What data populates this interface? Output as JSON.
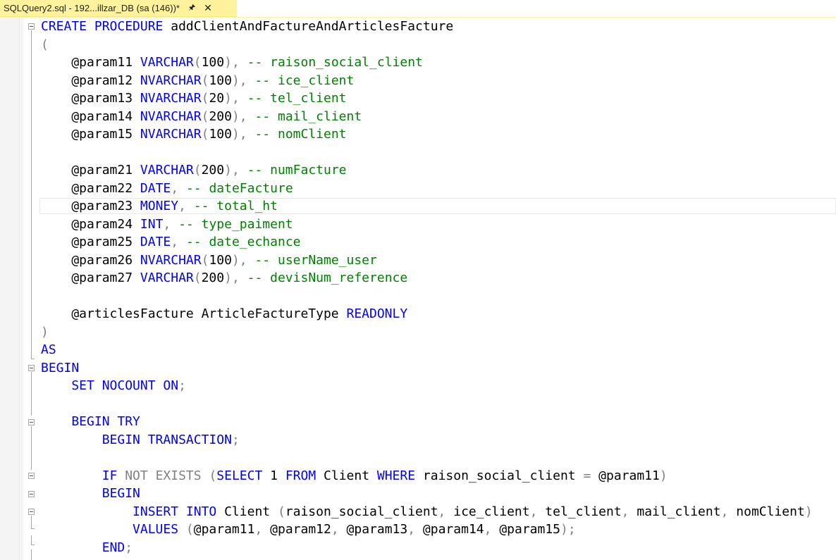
{
  "tab": {
    "title": "SQLQuery2.sql - 192...illzar_DB (sa (146))*",
    "pin_icon": "pin-icon",
    "close_icon": "close-icon"
  },
  "code_lines": [
    [
      {
        "t": "CREATE PROCEDURE ",
        "c": "kw"
      },
      {
        "t": "addClientAndFactureAndArticlesFacture",
        "c": "id"
      }
    ],
    [
      {
        "t": "(",
        "c": "op"
      }
    ],
    [
      {
        "t": "    @param11 ",
        "c": "id"
      },
      {
        "t": "VARCHAR",
        "c": "kw"
      },
      {
        "t": "(",
        "c": "op"
      },
      {
        "t": "100",
        "c": "id"
      },
      {
        "t": "), ",
        "c": "op"
      },
      {
        "t": "-- raison_social_client",
        "c": "cm"
      }
    ],
    [
      {
        "t": "    @param12 ",
        "c": "id"
      },
      {
        "t": "NVARCHAR",
        "c": "kw"
      },
      {
        "t": "(",
        "c": "op"
      },
      {
        "t": "100",
        "c": "id"
      },
      {
        "t": "), ",
        "c": "op"
      },
      {
        "t": "-- ice_client",
        "c": "cm"
      }
    ],
    [
      {
        "t": "    @param13 ",
        "c": "id"
      },
      {
        "t": "NVARCHAR",
        "c": "kw"
      },
      {
        "t": "(",
        "c": "op"
      },
      {
        "t": "20",
        "c": "id"
      },
      {
        "t": "), ",
        "c": "op"
      },
      {
        "t": "-- tel_client",
        "c": "cm"
      }
    ],
    [
      {
        "t": "    @param14 ",
        "c": "id"
      },
      {
        "t": "NVARCHAR",
        "c": "kw"
      },
      {
        "t": "(",
        "c": "op"
      },
      {
        "t": "200",
        "c": "id"
      },
      {
        "t": "), ",
        "c": "op"
      },
      {
        "t": "-- mail_client",
        "c": "cm"
      }
    ],
    [
      {
        "t": "    @param15 ",
        "c": "id"
      },
      {
        "t": "NVARCHAR",
        "c": "kw"
      },
      {
        "t": "(",
        "c": "op"
      },
      {
        "t": "100",
        "c": "id"
      },
      {
        "t": "), ",
        "c": "op"
      },
      {
        "t": "-- nomClient",
        "c": "cm"
      }
    ],
    [],
    [
      {
        "t": "    @param21 ",
        "c": "id"
      },
      {
        "t": "VARCHAR",
        "c": "kw"
      },
      {
        "t": "(",
        "c": "op"
      },
      {
        "t": "200",
        "c": "id"
      },
      {
        "t": "), ",
        "c": "op"
      },
      {
        "t": "-- numFacture",
        "c": "cm"
      }
    ],
    [
      {
        "t": "    @param22 ",
        "c": "id"
      },
      {
        "t": "DATE",
        "c": "kw"
      },
      {
        "t": ", ",
        "c": "op"
      },
      {
        "t": "-- dateFacture",
        "c": "cm"
      }
    ],
    [
      {
        "t": "    @param23 ",
        "c": "id"
      },
      {
        "t": "MONEY",
        "c": "kw"
      },
      {
        "t": ", ",
        "c": "op"
      },
      {
        "t": "-- total_ht",
        "c": "cm"
      }
    ],
    [
      {
        "t": "    @param24 ",
        "c": "id"
      },
      {
        "t": "INT",
        "c": "kw"
      },
      {
        "t": ", ",
        "c": "op"
      },
      {
        "t": "-- type_paiment",
        "c": "cm"
      }
    ],
    [
      {
        "t": "    @param25 ",
        "c": "id"
      },
      {
        "t": "DATE",
        "c": "kw"
      },
      {
        "t": ", ",
        "c": "op"
      },
      {
        "t": "-- date_echance",
        "c": "cm"
      }
    ],
    [
      {
        "t": "    @param26 ",
        "c": "id"
      },
      {
        "t": "NVARCHAR",
        "c": "kw"
      },
      {
        "t": "(",
        "c": "op"
      },
      {
        "t": "100",
        "c": "id"
      },
      {
        "t": "), ",
        "c": "op"
      },
      {
        "t": "-- userName_user",
        "c": "cm"
      }
    ],
    [
      {
        "t": "    @param27 ",
        "c": "id"
      },
      {
        "t": "VARCHAR",
        "c": "kw"
      },
      {
        "t": "(",
        "c": "op"
      },
      {
        "t": "200",
        "c": "id"
      },
      {
        "t": "), ",
        "c": "op"
      },
      {
        "t": "-- devisNum_reference",
        "c": "cm"
      }
    ],
    [],
    [
      {
        "t": "    @articlesFacture ArticleFactureType ",
        "c": "id"
      },
      {
        "t": "READONLY",
        "c": "kw"
      }
    ],
    [
      {
        "t": ")",
        "c": "op"
      }
    ],
    [
      {
        "t": "AS",
        "c": "kw"
      }
    ],
    [
      {
        "t": "BEGIN",
        "c": "kw"
      }
    ],
    [
      {
        "t": "    SET NOCOUNT ON",
        "c": "kw"
      },
      {
        "t": ";",
        "c": "op"
      }
    ],
    [],
    [
      {
        "t": "    BEGIN TRY",
        "c": "kw"
      }
    ],
    [
      {
        "t": "        BEGIN TRANSACTION",
        "c": "kw"
      },
      {
        "t": ";",
        "c": "op"
      }
    ],
    [],
    [
      {
        "t": "        IF ",
        "c": "kw"
      },
      {
        "t": "NOT EXISTS ",
        "c": "op"
      },
      {
        "t": "(",
        "c": "op"
      },
      {
        "t": "SELECT ",
        "c": "kw"
      },
      {
        "t": "1 ",
        "c": "id"
      },
      {
        "t": "FROM ",
        "c": "kw"
      },
      {
        "t": "Client ",
        "c": "id"
      },
      {
        "t": "WHERE ",
        "c": "kw"
      },
      {
        "t": "raison_social_client ",
        "c": "id"
      },
      {
        "t": "= ",
        "c": "op"
      },
      {
        "t": "@param11",
        "c": "id"
      },
      {
        "t": ")",
        "c": "op"
      }
    ],
    [
      {
        "t": "        BEGIN",
        "c": "kw"
      }
    ],
    [
      {
        "t": "            INSERT INTO ",
        "c": "kw"
      },
      {
        "t": "Client ",
        "c": "id"
      },
      {
        "t": "(",
        "c": "op"
      },
      {
        "t": "raison_social_client",
        "c": "id"
      },
      {
        "t": ", ",
        "c": "op"
      },
      {
        "t": "ice_client",
        "c": "id"
      },
      {
        "t": ", ",
        "c": "op"
      },
      {
        "t": "tel_client",
        "c": "id"
      },
      {
        "t": ", ",
        "c": "op"
      },
      {
        "t": "mail_client",
        "c": "id"
      },
      {
        "t": ", ",
        "c": "op"
      },
      {
        "t": "nomClient",
        "c": "id"
      },
      {
        "t": ")",
        "c": "op"
      }
    ],
    [
      {
        "t": "            VALUES ",
        "c": "kw"
      },
      {
        "t": "(",
        "c": "op"
      },
      {
        "t": "@param11",
        "c": "id"
      },
      {
        "t": ", ",
        "c": "op"
      },
      {
        "t": "@param12",
        "c": "id"
      },
      {
        "t": ", ",
        "c": "op"
      },
      {
        "t": "@param13",
        "c": "id"
      },
      {
        "t": ", ",
        "c": "op"
      },
      {
        "t": "@param14",
        "c": "id"
      },
      {
        "t": ", ",
        "c": "op"
      },
      {
        "t": "@param15",
        "c": "id"
      },
      {
        "t": ");",
        "c": "op"
      }
    ],
    [
      {
        "t": "        END",
        "c": "kw"
      },
      {
        "t": ";",
        "c": "op"
      }
    ]
  ],
  "colors": {
    "keyword": "#0000ff",
    "comment": "#008000",
    "operator": "#808080",
    "identifier": "#000000",
    "tab_active": "#fff29d"
  }
}
